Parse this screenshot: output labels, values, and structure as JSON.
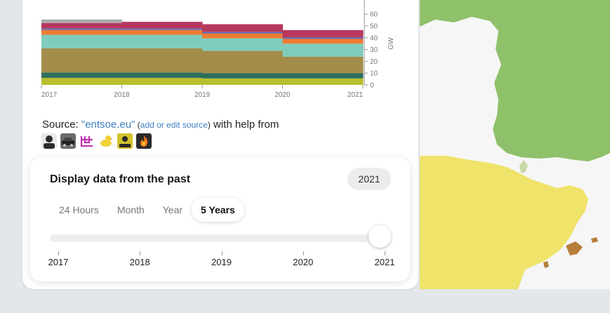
{
  "chart_data": {
    "type": "area",
    "x": [
      "2017",
      "2018",
      "2019",
      "2020",
      "2021"
    ],
    "ylabel": "GW",
    "yticks": [
      "0",
      "10",
      "20",
      "30",
      "40",
      "50",
      "60"
    ],
    "ylim": [
      0,
      62
    ],
    "stack": [
      {
        "color": "#b9bf2e",
        "values": [
          6,
          6,
          5.5,
          5.5
        ]
      },
      {
        "color": "#2f6e5c",
        "values": [
          4.5,
          4.5,
          4.5,
          4.5
        ]
      },
      {
        "color": "#a48c4a",
        "values": [
          20.5,
          20.5,
          19,
          14
        ]
      },
      {
        "color": "#7fccbc",
        "values": [
          11.5,
          11.5,
          10.5,
          11
        ]
      },
      {
        "color": "#ee7b32",
        "values": [
          4,
          4,
          4,
          4
        ]
      },
      {
        "color": "#6f68a8",
        "values": [
          1.5,
          1.5,
          1.5,
          1.5
        ]
      },
      {
        "color": "#b8385d",
        "values": [
          4.5,
          5.5,
          6.5,
          6
        ]
      },
      {
        "color": "#a9a9a9",
        "values": [
          3,
          0,
          0,
          0
        ]
      }
    ]
  },
  "source": {
    "prefix": "Source: ",
    "link": "\"entsoe.eu\"",
    "open": " (",
    "edit_link": "add or edit source",
    "close": ")",
    "suffix": " with help from"
  },
  "contributors": [
    {
      "icon": "avatar-portrait",
      "color": "#4a4a4a"
    },
    {
      "icon": "avatar-car",
      "color": "#555555"
    },
    {
      "icon": "avatar-logo",
      "color": "#c034b0"
    },
    {
      "icon": "avatar-duck",
      "color": "#f1d23b"
    },
    {
      "icon": "avatar-cartoon",
      "color": "#d4c22b"
    },
    {
      "icon": "avatar-fire",
      "color": "#333333"
    }
  ],
  "time_card": {
    "title": "Display data from the past",
    "selected_year": "2021",
    "tabs": [
      "24 Hours",
      "Month",
      "Year",
      "5 Years"
    ],
    "active_tab": "5 Years",
    "slider_labels": [
      "2017",
      "2018",
      "2019",
      "2020",
      "2021"
    ],
    "slider_position": 1.0
  },
  "map": {
    "regions": [
      {
        "name": "france",
        "color": "#8fc16b"
      },
      {
        "name": "spain",
        "color": "#efe36a"
      },
      {
        "name": "islands",
        "color": "#b77d3a"
      }
    ]
  }
}
